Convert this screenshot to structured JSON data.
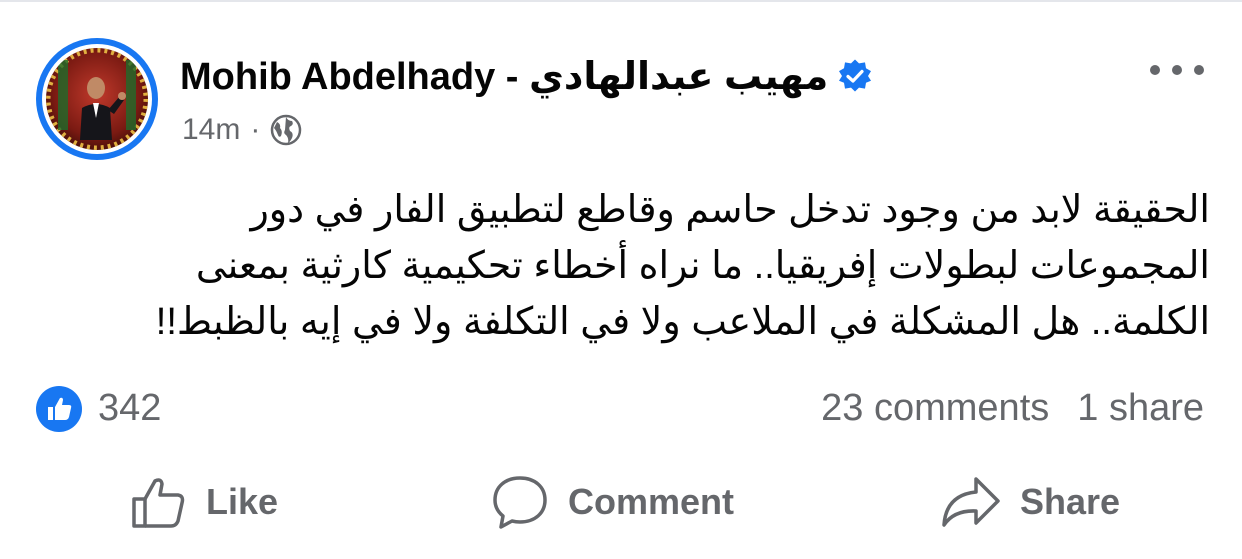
{
  "post": {
    "author_name": "Mohib Abdelhady -  مهيب عبدالهادي",
    "time": "14m",
    "separator": "·",
    "body_lines": [
      "الحقيقة لابد من وجود تدخل حاسم وقاطع لتطبيق الفار في دور",
      "المجموعات لبطولات إفريقيا.. ما نراه أخطاء تحكيمية كارثية بمعنى",
      "الكلمة.. هل المشكلة في الملاعب ولا في التكلفة ولا في إيه بالظبط!!"
    ],
    "reactions_count": "342",
    "comments_count": "23 comments",
    "shares_count": "1 share"
  },
  "actions": {
    "like_label": "Like",
    "comment_label": "Comment",
    "share_label": "Share"
  },
  "icons": {
    "verified": "verified-badge-icon",
    "audience": "globe-icon",
    "more": "more-options-icon",
    "reaction": "thumbs-up-icon",
    "like": "thumbs-up-outline-icon",
    "comment": "speech-bubble-icon",
    "share": "share-arrow-icon"
  },
  "colors": {
    "accent": "#1877f2",
    "text_primary": "#050505",
    "text_secondary": "#65676b",
    "divider": "#e4e6eb"
  }
}
